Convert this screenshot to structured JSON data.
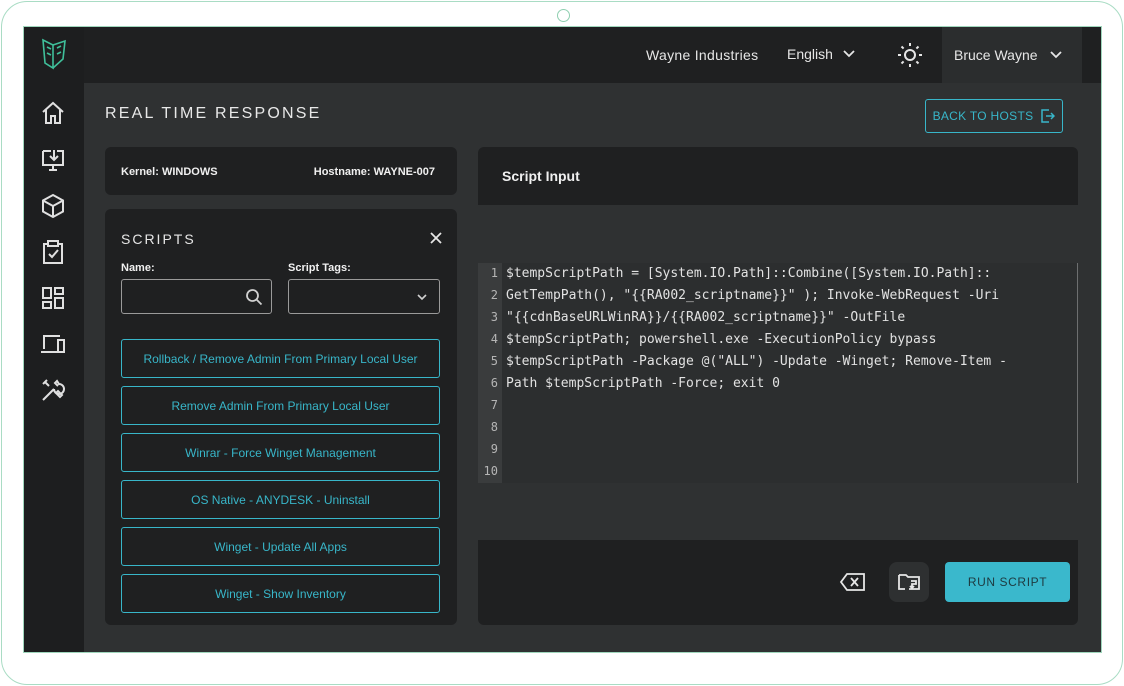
{
  "topbar": {
    "organization": "Wayne Industries",
    "language": "English",
    "user": "Bruce Wayne"
  },
  "sidebar": {
    "items": [
      {
        "name": "home",
        "icon": "home-icon"
      },
      {
        "name": "hosts",
        "icon": "monitor-download-icon"
      },
      {
        "name": "packages",
        "icon": "cube-icon"
      },
      {
        "name": "tasks",
        "icon": "clipboard-check-icon"
      },
      {
        "name": "dashboard",
        "icon": "grid-icon"
      },
      {
        "name": "devices",
        "icon": "devices-icon"
      },
      {
        "name": "tools",
        "icon": "tools-icon"
      }
    ]
  },
  "page": {
    "title": "REAL TIME RESPONSE",
    "back_button": "BACK TO HOSTS"
  },
  "host_info": {
    "kernel": "Kernel: WINDOWS",
    "hostname": "Hostname: WAYNE-007"
  },
  "scripts": {
    "title": "SCRIPTS",
    "name_label": "Name:",
    "name_value": "",
    "tags_label": "Script Tags:",
    "tags_value": "",
    "items": [
      "Rollback / Remove Admin From Primary Local User",
      "Remove Admin From Primary Local User",
      "Winrar - Force Winget Management",
      "OS Native - ANYDESK - Uninstall",
      "Winget - Update All Apps",
      "Winget - Show Inventory"
    ]
  },
  "script_input": {
    "title": "Script Input",
    "line_numbers": [
      "1",
      "2",
      "3",
      "4",
      "5",
      "6",
      "7",
      "8",
      "9",
      "10"
    ],
    "lines": [
      "$tempScriptPath = [System.IO.Path]::Combine([System.IO.Path]::",
      "GetTempPath(), \"{{RA002_scriptname}}\" ); Invoke-WebRequest -Uri",
      "\"{{cdnBaseURLWinRA}}/{{RA002_scriptname}}\" -OutFile",
      "$tempScriptPath; powershell.exe -ExecutionPolicy bypass",
      "$tempScriptPath -Package @(\"ALL\") -Update -Winget; Remove-Item -",
      "Path $tempScriptPath -Force; exit 0",
      "",
      "",
      "",
      ""
    ],
    "run_button": "RUN SCRIPT"
  },
  "colors": {
    "accent": "#38b6c9",
    "logo": "#3fbf9a",
    "background": "#2f3132",
    "panel": "#1f2021"
  }
}
